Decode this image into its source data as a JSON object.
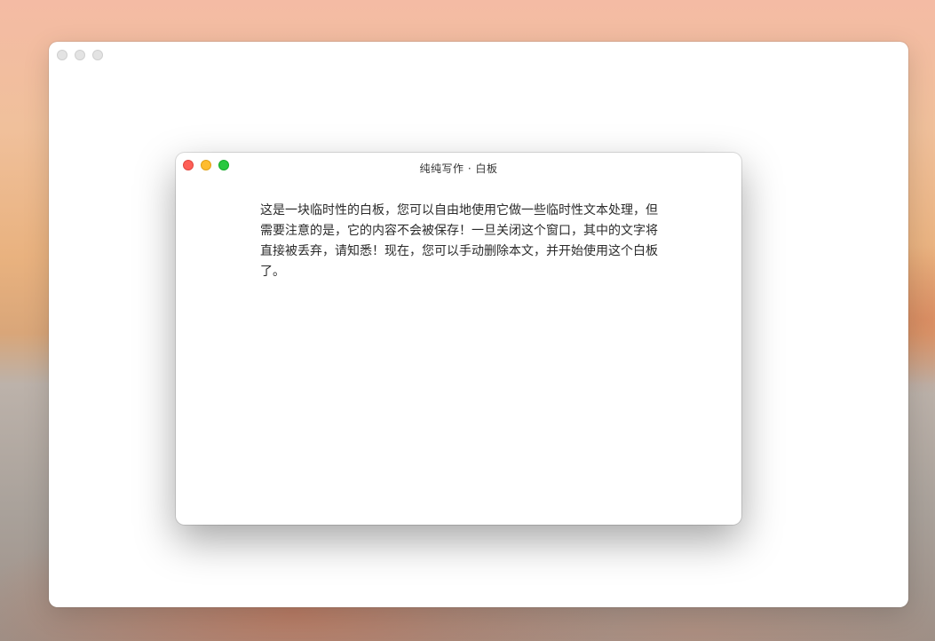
{
  "background_window": {
    "controls": [
      "close",
      "minimize",
      "zoom"
    ]
  },
  "editor_window": {
    "title": "纯纯写作 · 白板",
    "controls": [
      "close",
      "minimize",
      "zoom"
    ],
    "body_text": "这是一块临时性的白板，您可以自由地使用它做一些临时性文本处理，但需要注意的是，它的内容不会被保存！一旦关闭这个窗口，其中的文字将直接被丢弃，请知悉！现在，您可以手动删除本文，并开始使用这个白板了。"
  },
  "colors": {
    "close": "#fe5f57",
    "minimize": "#febc2e",
    "zoom": "#28c840",
    "inactive_control": "#e3e3e3"
  }
}
